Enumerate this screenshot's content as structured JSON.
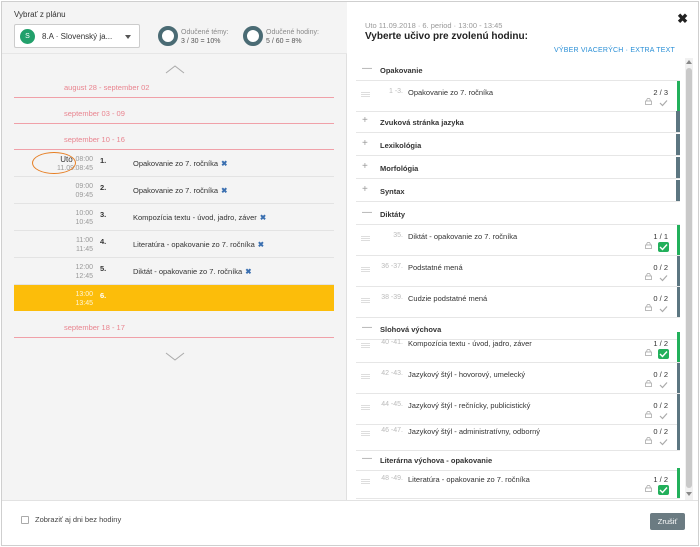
{
  "header": {
    "plan_label": "Vybrať z plánu",
    "class_avatar": "S",
    "class_name": "8.A · Slovenský ja...",
    "stat_topics_label": "Odučené témy:",
    "stat_topics_value": "3 / 30 = 10%",
    "stat_hours_label": "Odučené hodiny:",
    "stat_hours_value": "5 / 60 = 8%"
  },
  "weeks": [
    "august 28 - september 02",
    "september 03 - 09",
    "september 10 - 16",
    "september 18 - 17"
  ],
  "day": {
    "name": "Uto",
    "date": "11.09."
  },
  "lessons": [
    {
      "start": "08:00",
      "end": "08:45",
      "num": "1.",
      "subject": "Opakovanie zo 7. ročníka",
      "remove": "✖"
    },
    {
      "start": "09:00",
      "end": "09:45",
      "num": "2.",
      "subject": "Opakovanie zo 7. ročníka",
      "remove": "✖"
    },
    {
      "start": "10:00",
      "end": "10:45",
      "num": "3.",
      "subject": "Kompozícia textu - úvod, jadro, záver",
      "remove": "✖"
    },
    {
      "start": "11:00",
      "end": "11:45",
      "num": "4.",
      "subject": "Literatúra - opakovanie zo 7. ročníka",
      "remove": "✖"
    },
    {
      "start": "12:00",
      "end": "12:45",
      "num": "5.",
      "subject": "Diktát - opakovanie zo 7. ročníka",
      "remove": "✖"
    },
    {
      "start": "13:00",
      "end": "13:45",
      "num": "6.",
      "subject": "",
      "remove": ""
    }
  ],
  "footer": {
    "show_days_label": "Zobraziť aj dni bez hodiny",
    "close_label": "Zrušiť"
  },
  "right": {
    "subtitle": "Uto 11.09.2018 · 6. period · 13:00 - 13:45",
    "title": "Vyberte učivo pre zvolenú hodinu:",
    "links": "VÝBER VIACERÝCH · EXTRA TEXT",
    "close_icon": "✖"
  },
  "sections": [
    {
      "sign": "—",
      "name": "Opakovanie",
      "open": true
    },
    {
      "sign": "+",
      "name": "Zvuková stránka jazyka",
      "open": false
    },
    {
      "sign": "+",
      "name": "Lexikológia",
      "open": false
    },
    {
      "sign": "+",
      "name": "Morfológia",
      "open": false
    },
    {
      "sign": "+",
      "name": "Syntax",
      "open": false
    },
    {
      "sign": "—",
      "name": "Diktáty",
      "open": true
    },
    {
      "sign": "—",
      "name": "Slohová výchova",
      "open": true
    },
    {
      "sign": "—",
      "name": "Literárna výchova - opakovanie",
      "open": true
    }
  ],
  "items": [
    {
      "ord": "1 -3.",
      "name": "Opakovanie zo 7. ročníka",
      "count": "2 / 3",
      "checked": false,
      "bar": "#22b05b"
    },
    {
      "ord": "35.",
      "name": "Diktát - opakovanie zo 7. ročníka",
      "count": "1 / 1",
      "checked": true,
      "bar": "#22b05b"
    },
    {
      "ord": "36 -37.",
      "name": "Podstatné mená",
      "count": "0 / 2",
      "checked": false,
      "bar": "#5c7681"
    },
    {
      "ord": "38 -39.",
      "name": "Cudzie podstatné mená",
      "count": "0 / 2",
      "checked": false,
      "bar": "#5c7681"
    },
    {
      "ord": "40 -41.",
      "name": "Kompozícia textu - úvod, jadro, záver",
      "count": "1 / 2",
      "checked": true,
      "bar": "#22b05b"
    },
    {
      "ord": "42 -43.",
      "name": "Jazykový štýl - hovorový, umelecký",
      "count": "0 / 2",
      "checked": false,
      "bar": "#5c7681"
    },
    {
      "ord": "44 -45.",
      "name": "Jazykový štýl - rečnícky, publicistický",
      "count": "0 / 2",
      "checked": false,
      "bar": "#5c7681"
    },
    {
      "ord": "46 -47.",
      "name": "Jazykový štýl - administratívny, odborný",
      "count": "0 / 2",
      "checked": false,
      "bar": "#5c7681"
    },
    {
      "ord": "48 -49.",
      "name": "Literatúra - opakovanie zo 7. ročníka",
      "count": "1 / 2",
      "checked": true,
      "bar": "#22b05b"
    }
  ],
  "colors": {
    "accent": "#fcbd0a",
    "green": "#22b05b",
    "week": "#e9848f",
    "link": "#2a8fd6"
  }
}
